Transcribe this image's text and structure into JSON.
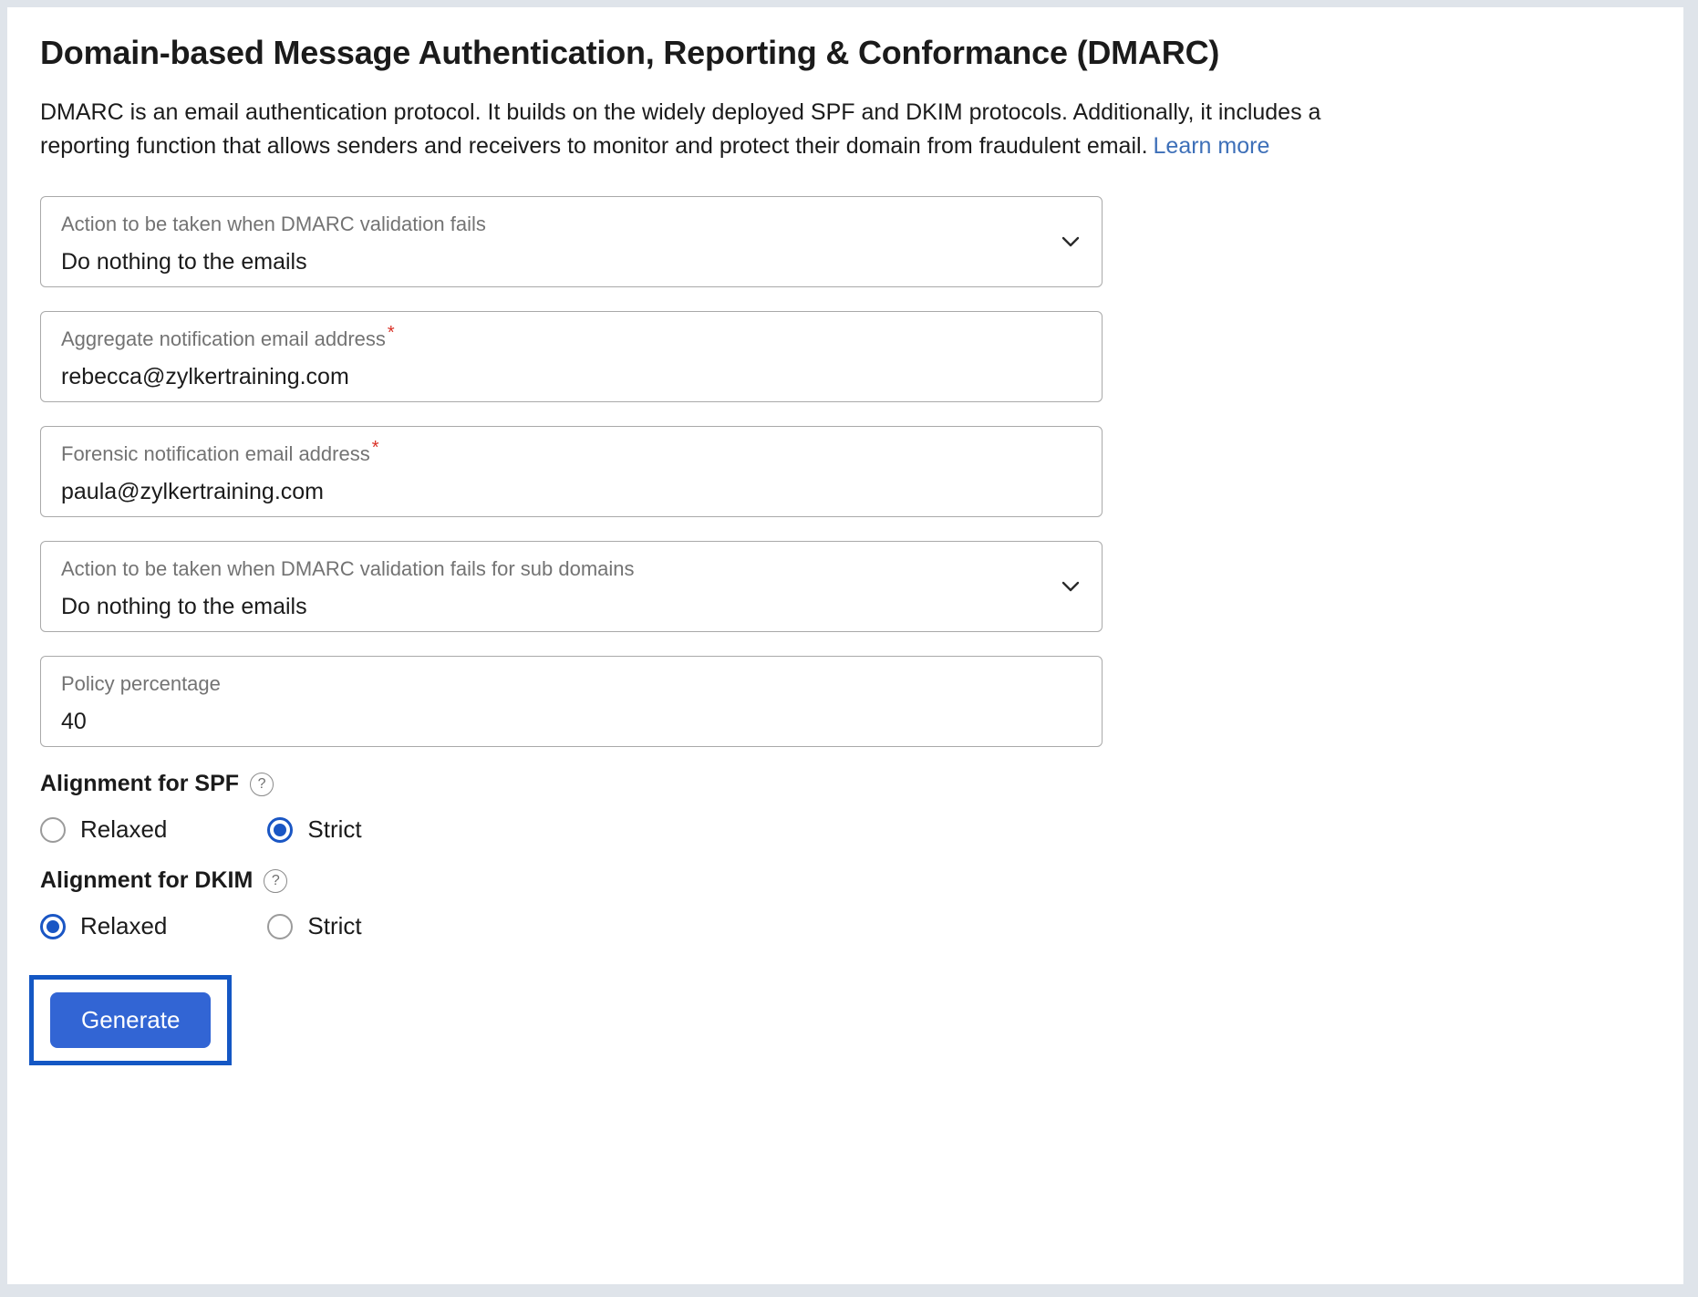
{
  "page": {
    "title": "Domain-based Message Authentication, Reporting & Conformance (DMARC)",
    "description": "DMARC is an email authentication protocol. It builds on the widely deployed SPF and DKIM protocols. Additionally, it includes a reporting function that allows senders and receivers to monitor and protect their domain from fraudulent email.",
    "learn_more_label": "Learn more"
  },
  "fields": {
    "dmarc_fail_action": {
      "label": "Action to be taken when DMARC validation fails",
      "value": "Do nothing to the emails",
      "icon": "chevron-down-icon"
    },
    "aggregate_email": {
      "label": "Aggregate notification email address",
      "required_marker": "*",
      "value": "rebecca@zylkertraining.com"
    },
    "forensic_email": {
      "label": "Forensic notification email address",
      "required_marker": "*",
      "value": "paula@zylkertraining.com"
    },
    "subdomain_fail_action": {
      "label": "Action to be taken when DMARC validation fails for sub domains",
      "value": "Do nothing to the emails",
      "icon": "chevron-down-icon"
    },
    "policy_percentage": {
      "label": "Policy percentage",
      "value": "40"
    }
  },
  "alignment_spf": {
    "title": "Alignment for SPF",
    "help_icon": "?",
    "options": [
      {
        "label": "Relaxed",
        "selected": false
      },
      {
        "label": "Strict",
        "selected": true
      }
    ],
    "selected": "Strict"
  },
  "alignment_dkim": {
    "title": "Alignment for DKIM",
    "help_icon": "?",
    "options": [
      {
        "label": "Relaxed",
        "selected": true
      },
      {
        "label": "Strict",
        "selected": false
      }
    ],
    "selected": "Relaxed"
  },
  "actions": {
    "generate_label": "Generate"
  },
  "colors": {
    "accent_blue": "#3265d4",
    "highlight_blue": "#1457c4",
    "link_blue": "#3d6fb8",
    "required_red": "#d93025",
    "frame_gray": "#dfe4ea"
  }
}
